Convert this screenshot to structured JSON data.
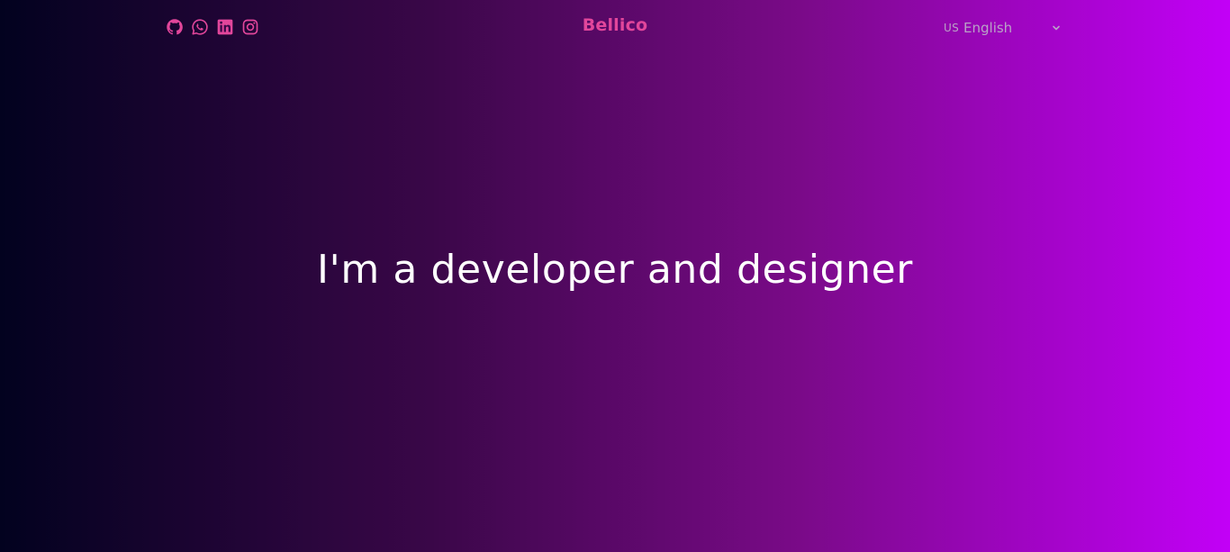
{
  "header": {
    "brand": "Bellico",
    "socials": [
      {
        "icon": "github-icon"
      },
      {
        "icon": "whatsapp-icon"
      },
      {
        "icon": "linkedin-icon"
      },
      {
        "icon": "instagram-icon"
      }
    ],
    "language": {
      "code": "US",
      "selected": "English",
      "chevron_icon": "chevron-down-icon"
    }
  },
  "hero": {
    "headline": "I'm a developer and designer"
  },
  "colors": {
    "accent": "#e2469b",
    "gradient_start": "#02021f",
    "gradient_end": "#c200f7",
    "text": "#ffffff",
    "muted": "#b9a3c6"
  }
}
